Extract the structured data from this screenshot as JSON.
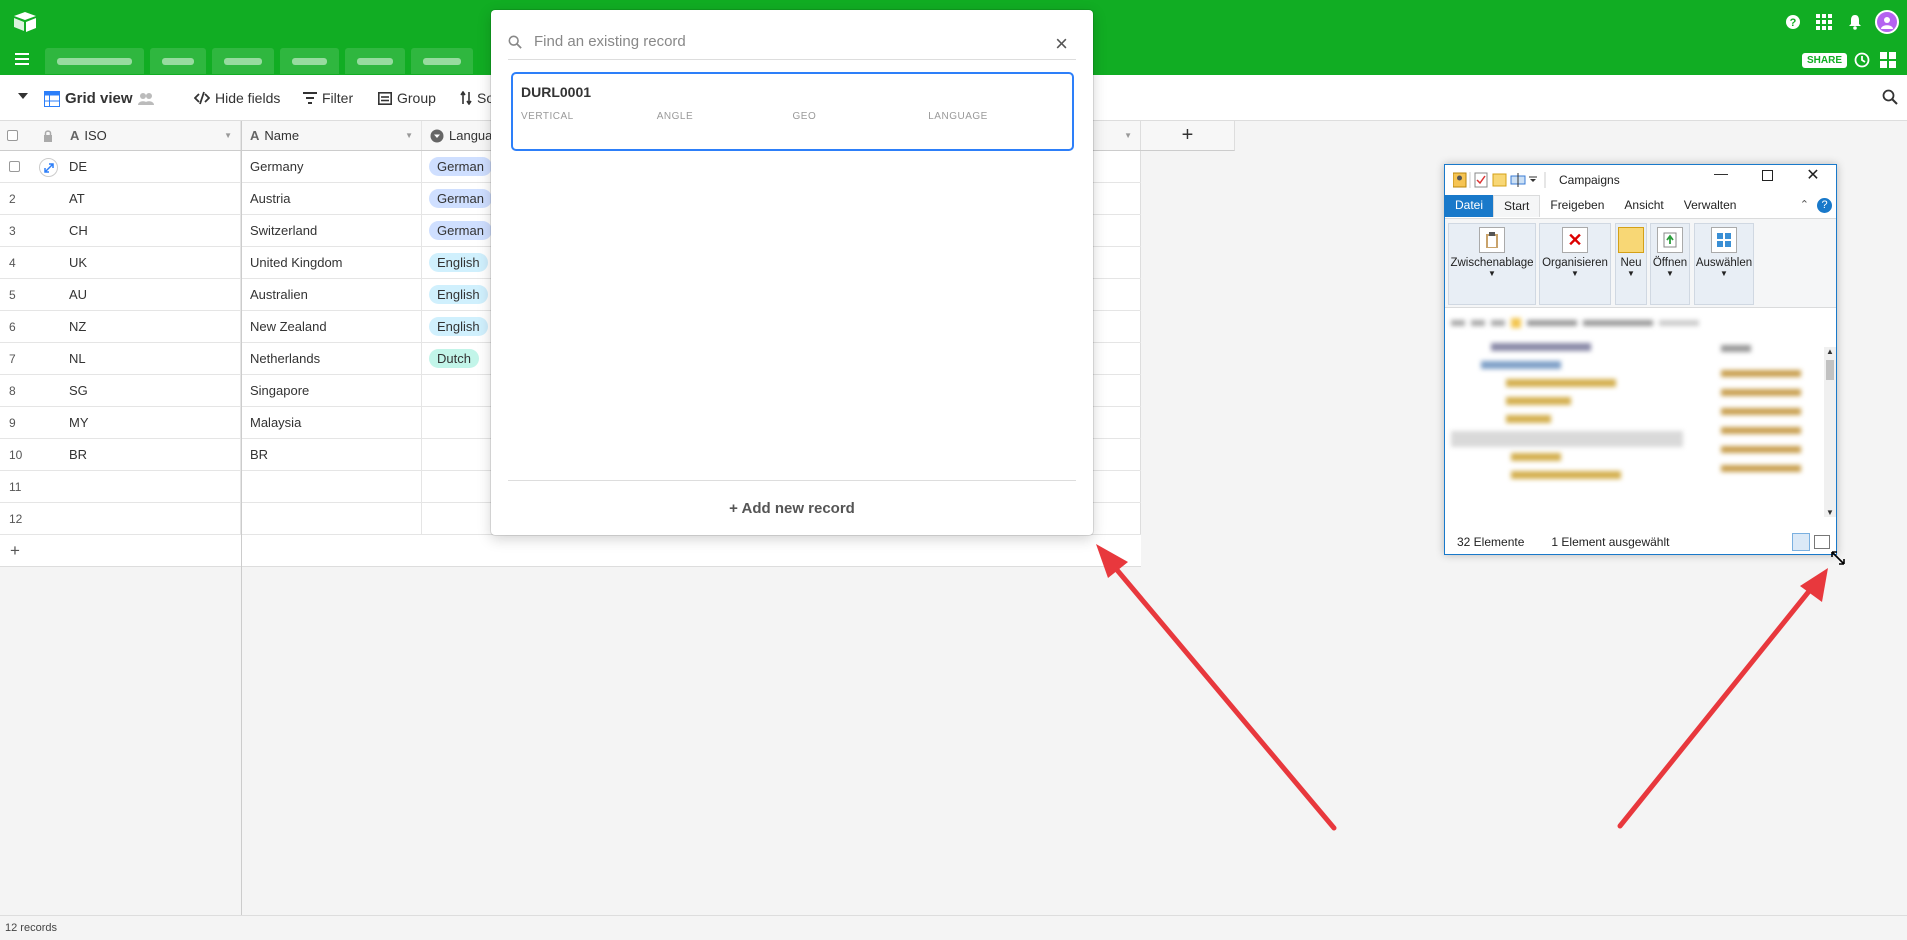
{
  "toolbar": {
    "view_name": "Grid view",
    "hide_fields": "Hide fields",
    "filter": "Filter",
    "group": "Group",
    "sort": "So"
  },
  "header_buttons": {
    "share": "SHARE"
  },
  "grid": {
    "columns": [
      "ISO",
      "Name",
      "Languag"
    ],
    "rows": [
      {
        "n": "",
        "iso": "DE",
        "name": "Germany",
        "lang": "German"
      },
      {
        "n": "2",
        "iso": "AT",
        "name": "Austria",
        "lang": "German"
      },
      {
        "n": "3",
        "iso": "CH",
        "name": "Switzerland",
        "lang": "German"
      },
      {
        "n": "4",
        "iso": "UK",
        "name": "United Kingdom",
        "lang": "English"
      },
      {
        "n": "5",
        "iso": "AU",
        "name": "Australien",
        "lang": "English"
      },
      {
        "n": "6",
        "iso": "NZ",
        "name": "New Zealand",
        "lang": "English"
      },
      {
        "n": "7",
        "iso": "NL",
        "name": "Netherlands",
        "lang": "Dutch"
      },
      {
        "n": "8",
        "iso": "SG",
        "name": "Singapore",
        "lang": ""
      },
      {
        "n": "9",
        "iso": "MY",
        "name": "Malaysia",
        "lang": ""
      },
      {
        "n": "10",
        "iso": "BR",
        "name": "BR",
        "lang": ""
      },
      {
        "n": "11",
        "iso": "",
        "name": "",
        "lang": ""
      },
      {
        "n": "12",
        "iso": "",
        "name": "",
        "lang": ""
      }
    ],
    "add_row": "+",
    "add_column": "+",
    "record_count": "12 records"
  },
  "lang_colors": {
    "German": "#cfdfff",
    "English": "#d0f0fd",
    "Dutch": "#c2f5e9"
  },
  "modal": {
    "search_placeholder": "Find an existing record",
    "close": "×",
    "record": {
      "title": "DURL0001",
      "fields": [
        "VERTICAL",
        "ANGLE",
        "GEO",
        "LANGUAGE"
      ]
    },
    "add_new": "+ Add new record"
  },
  "explorer": {
    "title": "Campaigns",
    "tabs": [
      "Datei",
      "Start",
      "Freigeben",
      "Ansicht",
      "Verwalten"
    ],
    "groups": [
      "Zwischenablage",
      "Organisieren",
      "Neu",
      "Öffnen",
      "Auswählen"
    ],
    "status_count": "32 Elemente",
    "status_selected": "1 Element ausgewählt"
  },
  "colors": {
    "brand_green": "#11ad23",
    "accent_blue": "#2d7ff9",
    "arrow_red": "#e8383d"
  }
}
